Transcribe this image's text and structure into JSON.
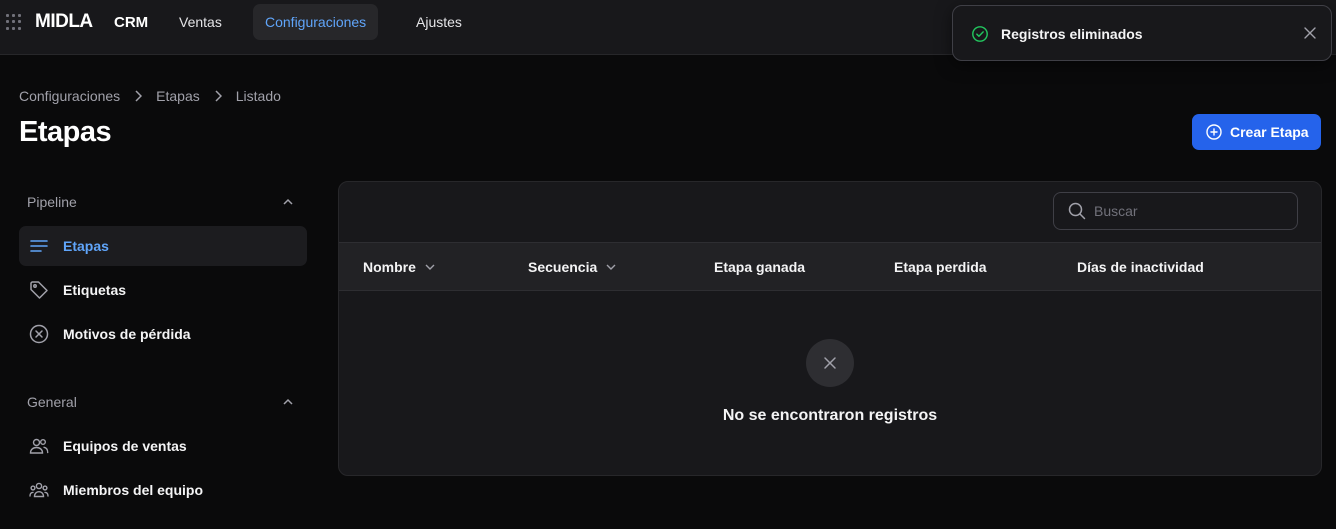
{
  "topbar": {
    "brand": "MIDLA",
    "product": "CRM",
    "nav": [
      {
        "label": "Ventas"
      },
      {
        "label": "Configuraciones",
        "active": true
      },
      {
        "label": "Ajustes"
      }
    ]
  },
  "toast": {
    "message": "Registros eliminados",
    "icon": "check-circle-icon",
    "accent": "#22c55e"
  },
  "breadcrumb": [
    "Configuraciones",
    "Etapas",
    "Listado"
  ],
  "page": {
    "title": "Etapas",
    "create_label": "Crear Etapa",
    "accent": "#2563eb"
  },
  "sidebar": {
    "groups": [
      {
        "label": "Pipeline",
        "items": [
          {
            "label": "Etapas",
            "icon": "list-icon",
            "active": true
          },
          {
            "label": "Etiquetas",
            "icon": "tag-icon"
          },
          {
            "label": "Motivos de pérdida",
            "icon": "x-circle-icon"
          }
        ]
      },
      {
        "label": "General",
        "items": [
          {
            "label": "Equipos de ventas",
            "icon": "users-icon"
          },
          {
            "label": "Miembros del equipo",
            "icon": "user-group-icon"
          }
        ]
      }
    ]
  },
  "table": {
    "search_placeholder": "Buscar",
    "columns": [
      {
        "label": "Nombre",
        "sortable": true
      },
      {
        "label": "Secuencia",
        "sortable": true
      },
      {
        "label": "Etapa ganada"
      },
      {
        "label": "Etapa perdida"
      },
      {
        "label": "Días de inactividad"
      }
    ],
    "empty_message": "No se encontraron registros"
  }
}
